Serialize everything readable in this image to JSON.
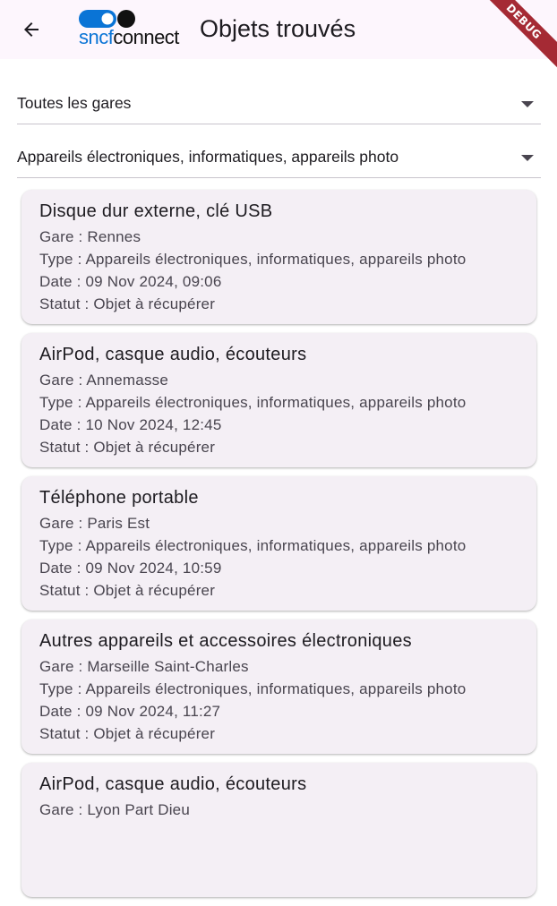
{
  "appbar": {
    "title": "Objets trouvés",
    "logo": {
      "part1": "sncf",
      "part2": "connect"
    },
    "debug_banner": "DEBUG",
    "back_icon": "arrow-left-icon"
  },
  "filters": {
    "station": {
      "value": "Toutes les gares",
      "icon": "dropdown-caret-icon"
    },
    "category": {
      "value": "Appareils électroniques, informatiques, appareils photo",
      "icon": "dropdown-caret-icon"
    }
  },
  "items": [
    {
      "title": "Disque dur externe, clé USB",
      "station": "Gare : Rennes",
      "type": "Type : Appareils électroniques, informatiques, appareils photo",
      "date": "Date : 09 Nov 2024, 09:06",
      "status": "Statut : Objet à récupérer"
    },
    {
      "title": "AirPod, casque audio, écouteurs",
      "station": "Gare : Annemasse",
      "type": "Type : Appareils électroniques, informatiques, appareils photo",
      "date": "Date : 10 Nov 2024, 12:45",
      "status": "Statut : Objet à récupérer"
    },
    {
      "title": "Téléphone portable",
      "station": "Gare : Paris Est",
      "type": "Type : Appareils électroniques, informatiques, appareils photo",
      "date": "Date : 09 Nov 2024, 10:59",
      "status": "Statut : Objet à récupérer"
    },
    {
      "title": "Autres appareils et accessoires électroniques",
      "station": "Gare : Marseille Saint-Charles",
      "type": "Type : Appareils électroniques, informatiques, appareils photo",
      "date": "Date : 09 Nov 2024, 11:27",
      "status": "Statut : Objet à récupérer"
    },
    {
      "title": "AirPod, casque audio, écouteurs",
      "station": "Gare : Lyon Part Dieu"
    }
  ],
  "colors": {
    "appbar_bg": "#fdf6fd",
    "card_bg": "#f4eff5",
    "logo_blue": "#0a74d6",
    "debug_red": "#a52a34"
  }
}
